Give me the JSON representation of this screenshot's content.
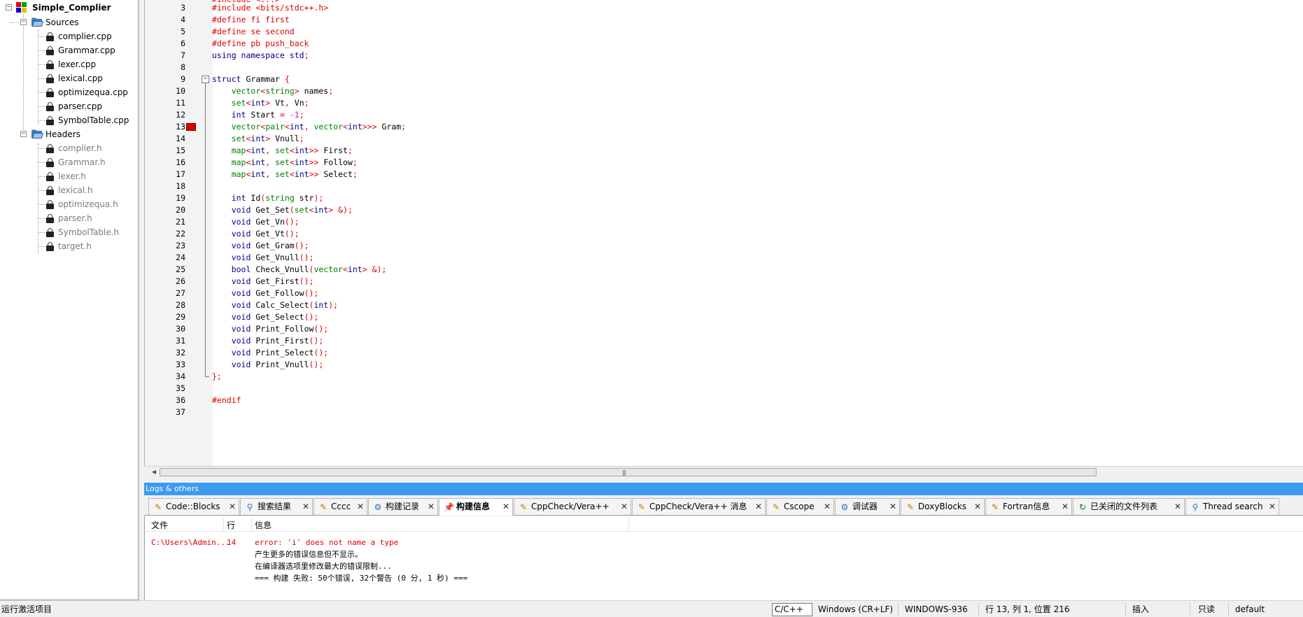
{
  "tree": {
    "project": "Simple_Complier",
    "sources_folder": "Sources",
    "sources": [
      "complier.cpp",
      "Grammar.cpp",
      "lexer.cpp",
      "lexical.cpp",
      "optimizequa.cpp",
      "parser.cpp",
      "SymbolTable.cpp"
    ],
    "headers_folder": "Headers",
    "headers": [
      "complier.h",
      "Grammar.h",
      "lexer.h",
      "lexical.h",
      "optimizequa.h",
      "parser.h",
      "SymbolTable.h",
      "target.h"
    ]
  },
  "editor": {
    "line_numbers": [
      "3",
      "4",
      "5",
      "6",
      "7",
      "8",
      "9",
      "10",
      "11",
      "12",
      "13",
      "14",
      "15",
      "16",
      "17",
      "18",
      "19",
      "20",
      "21",
      "22",
      "23",
      "24",
      "25",
      "26",
      "27",
      "28",
      "29",
      "30",
      "31",
      "32",
      "33",
      "34",
      "35",
      "36",
      "37"
    ],
    "breakpoint_line": "13"
  },
  "logs": {
    "title": "Logs & others",
    "tabs": [
      {
        "label": "Code::Blocks",
        "icon": "doc-icon"
      },
      {
        "label": "搜索结果",
        "icon": "search-icon"
      },
      {
        "label": "Cccc",
        "icon": "doc-icon"
      },
      {
        "label": "构建记录",
        "icon": "gear-icon"
      },
      {
        "label": "构建信息",
        "icon": "pin-icon"
      },
      {
        "label": "CppCheck/Vera++",
        "icon": "doc-icon"
      },
      {
        "label": "CppCheck/Vera++ 消息",
        "icon": "doc-icon"
      },
      {
        "label": "Cscope",
        "icon": "doc-icon"
      },
      {
        "label": "调试器",
        "icon": "gear-icon"
      },
      {
        "label": "DoxyBlocks",
        "icon": "doc-icon"
      },
      {
        "label": "Fortran信息",
        "icon": "doc-icon"
      },
      {
        "label": "已关闭的文件列表",
        "icon": "refresh-icon"
      },
      {
        "label": "Thread search",
        "icon": "search-icon"
      }
    ],
    "active_tab": "构建信息",
    "columns": {
      "file": "文件",
      "line": "行",
      "message": "信息"
    },
    "rows": [
      {
        "file": "C:\\Users\\Admin...",
        "line": "14",
        "message": "error: 'i' does not name a type"
      },
      {
        "file": "",
        "line": "",
        "message": "产生更多的错误信息但不显示。"
      },
      {
        "file": "",
        "line": "",
        "message": "在编译器选项里修改最大的错误限制..."
      },
      {
        "file": "",
        "line": "",
        "message": "=== 构建 失败: 50个错误, 32个警告 (0 分, 1 秒) ==="
      }
    ]
  },
  "status": {
    "left": "运行激活项目",
    "language": "C/C++",
    "eol": "Windows (CR+LF)",
    "encoding": "WINDOWS-936",
    "position": "行 13, 列 1, 位置 216",
    "mode": "插入",
    "readonly": "只读",
    "profile": "default"
  },
  "colors": {
    "keyword": "#00008b",
    "type": "#008000",
    "preprocessor": "#e00000",
    "number": "#f000f0",
    "logs_title_bg": "#3c9aef"
  }
}
